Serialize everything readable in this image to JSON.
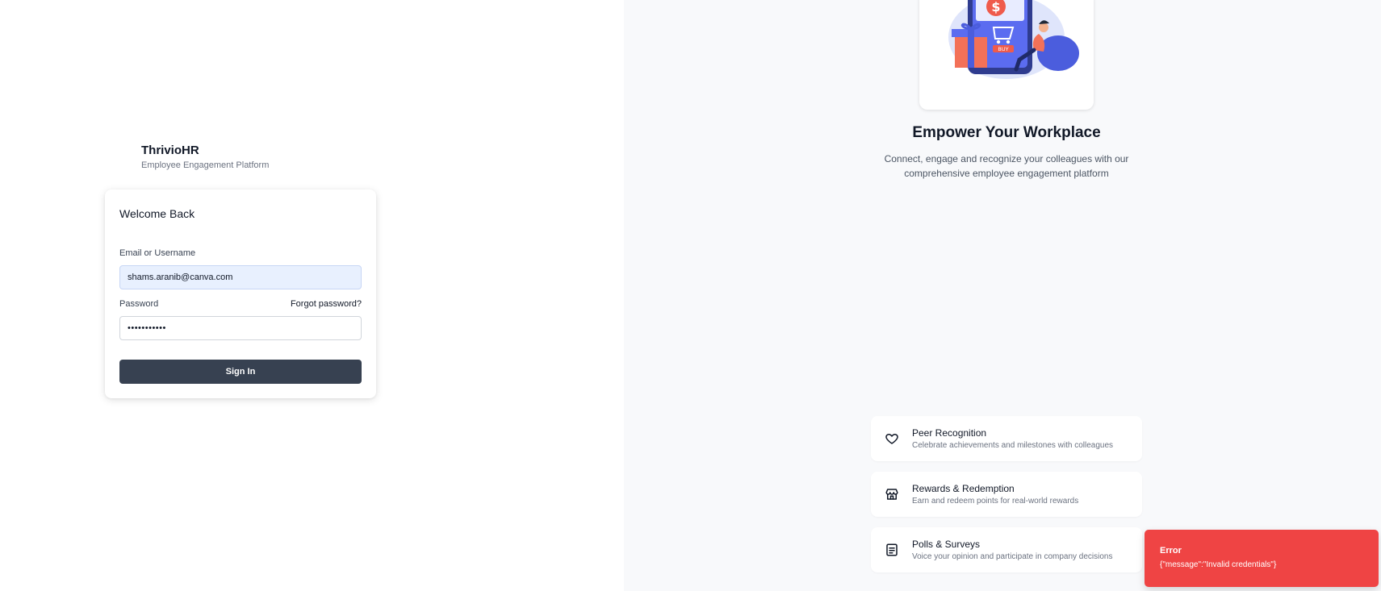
{
  "brand": {
    "name": "ThrivioHR",
    "tagline": "Employee Engagement Platform"
  },
  "login": {
    "title": "Welcome Back",
    "email_label": "Email or Username",
    "email_value": "shams.aranib@canva.com",
    "password_label": "Password",
    "password_value": "•••••••••••",
    "forgot_label": "Forgot password?",
    "signin_label": "Sign In"
  },
  "hero": {
    "title": "Empower Your Workplace",
    "subtitle": "Connect, engage and recognize your colleagues with our comprehensive employee engagement platform",
    "illustration_text": "BUY"
  },
  "features": [
    {
      "icon": "heart-icon",
      "title": "Peer Recognition",
      "desc": "Celebrate achievements and milestones with colleagues"
    },
    {
      "icon": "store-icon",
      "title": "Rewards & Redemption",
      "desc": "Earn and redeem points for real-world rewards"
    },
    {
      "icon": "document-icon",
      "title": "Polls & Surveys",
      "desc": "Voice your opinion and participate in company decisions"
    }
  ],
  "toast": {
    "title": "Error",
    "message": "{\"message\":\"Invalid credentials\"}"
  },
  "colors": {
    "primary_button": "#374151",
    "toast_error": "#ef4444",
    "right_background": "#f8f9fb",
    "autofill_background": "#e8f0fe"
  }
}
